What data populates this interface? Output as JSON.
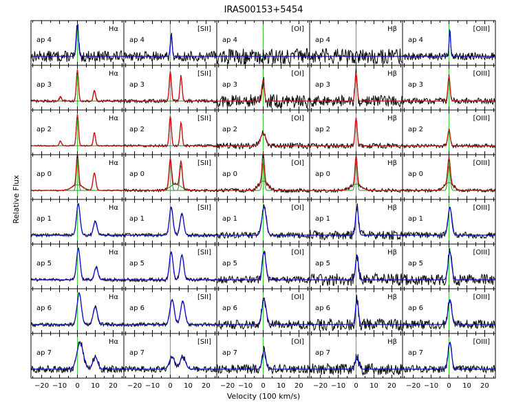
{
  "chart_data": {
    "type": "line",
    "title": "IRAS00153+5454",
    "xlabel": "Velocity (100 km/s)",
    "ylabel": "Relative Flux",
    "xlim": [
      -26,
      26
    ],
    "x_ticks": [
      -20,
      -10,
      0,
      10,
      20
    ],
    "x_tick_labels": [
      "−20",
      "−10",
      "0",
      "10",
      "20"
    ],
    "columns": [
      "Hα",
      "[SII]",
      "[OI]",
      "Hβ",
      "[OIII]"
    ],
    "rows": [
      "ap 4",
      "ap 3",
      "ap 2",
      "ap 0",
      "ap 1",
      "ap 5",
      "ap 6",
      "ap 7"
    ],
    "reference_line_x": 0,
    "colors": {
      "observed": "#000000",
      "total_fit": "#1010d0",
      "multi_fit": "#d01010",
      "components": "#2a8a2a",
      "reference": "#33cc33"
    },
    "panels": [
      {
        "row": "ap 4",
        "col": "Hα",
        "lines": [
          {
            "c": 0,
            "a": 1.0,
            "w": 0.6
          }
        ],
        "noise": 0.18,
        "fit": "single"
      },
      {
        "row": "ap 4",
        "col": "[SII]",
        "lines": [
          {
            "c": 0.5,
            "a": 0.7,
            "w": 0.5
          }
        ],
        "noise": 0.16,
        "fit": "single"
      },
      {
        "row": "ap 4",
        "col": "[OI]",
        "lines": [],
        "noise": 0.25,
        "fit": "single"
      },
      {
        "row": "ap 4",
        "col": "Hβ",
        "lines": [],
        "noise": 0.25,
        "fit": "single"
      },
      {
        "row": "ap 4",
        "col": "[OIII]",
        "lines": [
          {
            "c": 0.5,
            "a": 0.9,
            "w": 0.4
          }
        ],
        "noise": 0.12,
        "fit": "single"
      },
      {
        "row": "ap 3",
        "col": "Hα",
        "lines": [
          {
            "c": 0,
            "a": 1.0,
            "w": 0.6
          },
          {
            "c": 9.5,
            "a": 0.35,
            "w": 0.6
          },
          {
            "c": -9.5,
            "a": 0.15,
            "w": 0.6
          }
        ],
        "noise": 0.04,
        "fit": "multi"
      },
      {
        "row": "ap 3",
        "col": "[SII]",
        "lines": [
          {
            "c": 0,
            "a": 0.95,
            "w": 0.6
          },
          {
            "c": 6,
            "a": 0.8,
            "w": 0.6
          }
        ],
        "noise": 0.06,
        "fit": "multi"
      },
      {
        "row": "ap 3",
        "col": "[OI]",
        "lines": [
          {
            "c": 0,
            "a": 0.7,
            "w": 0.6
          }
        ],
        "noise": 0.22,
        "fit": "multi"
      },
      {
        "row": "ap 3",
        "col": "Hβ",
        "lines": [
          {
            "c": 0,
            "a": 0.9,
            "w": 0.6
          }
        ],
        "noise": 0.18,
        "fit": "multi"
      },
      {
        "row": "ap 3",
        "col": "[OIII]",
        "lines": [
          {
            "c": 0,
            "a": 0.8,
            "w": 0.6
          }
        ],
        "noise": 0.1,
        "fit": "multi"
      },
      {
        "row": "ap 2",
        "col": "Hα",
        "lines": [
          {
            "c": 0,
            "a": 1.0,
            "w": 0.6
          },
          {
            "c": 9.5,
            "a": 0.42,
            "w": 0.6
          },
          {
            "c": -9.5,
            "a": 0.15,
            "w": 0.6
          }
        ],
        "noise": 0.02,
        "fit": "multi"
      },
      {
        "row": "ap 2",
        "col": "[SII]",
        "lines": [
          {
            "c": 0,
            "a": 0.95,
            "w": 0.6
          },
          {
            "c": 6,
            "a": 0.75,
            "w": 0.6
          }
        ],
        "noise": 0.04,
        "fit": "multi"
      },
      {
        "row": "ap 2",
        "col": "[OI]",
        "lines": [
          {
            "c": 0,
            "a": 0.4,
            "w": 1.5
          }
        ],
        "noise": 0.1,
        "fit": "multi"
      },
      {
        "row": "ap 2",
        "col": "Hβ",
        "lines": [
          {
            "c": 0,
            "a": 0.9,
            "w": 0.6
          }
        ],
        "noise": 0.08,
        "fit": "multi"
      },
      {
        "row": "ap 2",
        "col": "[OIII]",
        "lines": [
          {
            "c": 0,
            "a": 0.5,
            "w": 0.7
          }
        ],
        "noise": 0.06,
        "fit": "multi"
      },
      {
        "row": "ap 0",
        "col": "Hα",
        "lines": [
          {
            "c": 0,
            "a": 1.0,
            "w": 0.6
          },
          {
            "c": 0,
            "a": 0.18,
            "w": 3.0
          },
          {
            "c": 9.5,
            "a": 0.55,
            "w": 0.8
          }
        ],
        "noise": 0.02,
        "fit": "multi"
      },
      {
        "row": "ap 0",
        "col": "[SII]",
        "lines": [
          {
            "c": 0,
            "a": 0.9,
            "w": 0.7
          },
          {
            "c": 6,
            "a": 0.8,
            "w": 0.7
          },
          {
            "c": 3,
            "a": 0.2,
            "w": 3.0
          }
        ],
        "noise": 0.04,
        "fit": "multi"
      },
      {
        "row": "ap 0",
        "col": "[OI]",
        "lines": [
          {
            "c": 0,
            "a": 0.9,
            "w": 0.6
          },
          {
            "c": 0,
            "a": 0.3,
            "w": 2.5
          }
        ],
        "noise": 0.06,
        "fit": "multi"
      },
      {
        "row": "ap 0",
        "col": "Hβ",
        "lines": [
          {
            "c": 0,
            "a": 0.9,
            "w": 0.6
          },
          {
            "c": 0,
            "a": 0.2,
            "w": 3.0
          }
        ],
        "noise": 0.06,
        "fit": "multi"
      },
      {
        "row": "ap 0",
        "col": "[OIII]",
        "lines": [
          {
            "c": 0,
            "a": 0.8,
            "w": 0.7
          },
          {
            "c": 0,
            "a": 0.25,
            "w": 2.5
          }
        ],
        "noise": 0.05,
        "fit": "multi"
      },
      {
        "row": "ap 1",
        "col": "Hα",
        "lines": [
          {
            "c": 0.5,
            "a": 1.0,
            "w": 1.0
          },
          {
            "c": 10,
            "a": 0.45,
            "w": 1.0
          }
        ],
        "noise": 0.05,
        "fit": "single"
      },
      {
        "row": "ap 1",
        "col": "[SII]",
        "lines": [
          {
            "c": 0.5,
            "a": 0.9,
            "w": 1.0
          },
          {
            "c": 6.5,
            "a": 0.7,
            "w": 1.0
          }
        ],
        "noise": 0.06,
        "fit": "single"
      },
      {
        "row": "ap 1",
        "col": "[OI]",
        "lines": [
          {
            "c": 0.5,
            "a": 0.9,
            "w": 1.2
          }
        ],
        "noise": 0.1,
        "fit": "single"
      },
      {
        "row": "ap 1",
        "col": "Hβ",
        "lines": [
          {
            "c": 0.5,
            "a": 0.9,
            "w": 0.8
          }
        ],
        "noise": 0.15,
        "fit": "single"
      },
      {
        "row": "ap 1",
        "col": "[OIII]",
        "lines": [
          {
            "c": 0.5,
            "a": 0.9,
            "w": 1.0
          }
        ],
        "noise": 0.1,
        "fit": "single"
      },
      {
        "row": "ap 5",
        "col": "Hα",
        "lines": [
          {
            "c": 0.5,
            "a": 1.0,
            "w": 1.0
          },
          {
            "c": 10.5,
            "a": 0.4,
            "w": 1.0
          }
        ],
        "noise": 0.05,
        "fit": "single"
      },
      {
        "row": "ap 5",
        "col": "[SII]",
        "lines": [
          {
            "c": 0.5,
            "a": 0.9,
            "w": 1.0
          },
          {
            "c": 6.5,
            "a": 0.8,
            "w": 1.0
          }
        ],
        "noise": 0.06,
        "fit": "single"
      },
      {
        "row": "ap 5",
        "col": "[OI]",
        "lines": [
          {
            "c": 0.5,
            "a": 0.9,
            "w": 1.0
          }
        ],
        "noise": 0.12,
        "fit": "single"
      },
      {
        "row": "ap 5",
        "col": "Hβ",
        "lines": [
          {
            "c": 0.5,
            "a": 0.8,
            "w": 0.8
          }
        ],
        "noise": 0.2,
        "fit": "single"
      },
      {
        "row": "ap 5",
        "col": "[OIII]",
        "lines": [
          {
            "c": 0.5,
            "a": 0.9,
            "w": 1.0
          }
        ],
        "noise": 0.18,
        "fit": "single"
      },
      {
        "row": "ap 6",
        "col": "Hα",
        "lines": [
          {
            "c": 1,
            "a": 1.0,
            "w": 1.2
          },
          {
            "c": 10,
            "a": 0.55,
            "w": 1.2
          }
        ],
        "noise": 0.06,
        "fit": "single"
      },
      {
        "row": "ap 6",
        "col": "[SII]",
        "lines": [
          {
            "c": 1,
            "a": 0.8,
            "w": 1.2
          },
          {
            "c": 7,
            "a": 0.75,
            "w": 1.2
          }
        ],
        "noise": 0.06,
        "fit": "single"
      },
      {
        "row": "ap 6",
        "col": "[OI]",
        "lines": [
          {
            "c": 0.5,
            "a": 0.8,
            "w": 1.2
          }
        ],
        "noise": 0.15,
        "fit": "single"
      },
      {
        "row": "ap 6",
        "col": "Hβ",
        "lines": [
          {
            "c": 0.5,
            "a": 0.8,
            "w": 0.8
          }
        ],
        "noise": 0.2,
        "fit": "single"
      },
      {
        "row": "ap 6",
        "col": "[OIII]",
        "lines": [
          {
            "c": 0.5,
            "a": 0.8,
            "w": 1.0
          }
        ],
        "noise": 0.15,
        "fit": "single"
      },
      {
        "row": "ap 7",
        "col": "Hα",
        "lines": [
          {
            "c": 1.5,
            "a": 0.85,
            "w": 1.8
          },
          {
            "c": 10,
            "a": 0.4,
            "w": 1.3
          }
        ],
        "noise": 0.12,
        "fit": "single"
      },
      {
        "row": "ap 7",
        "col": "[SII]",
        "lines": [
          {
            "c": 1,
            "a": 0.4,
            "w": 1.5
          },
          {
            "c": 7,
            "a": 0.4,
            "w": 1.5
          }
        ],
        "noise": 0.1,
        "fit": "single"
      },
      {
        "row": "ap 7",
        "col": "[OI]",
        "lines": [
          {
            "c": 0.5,
            "a": 0.6,
            "w": 1.0
          }
        ],
        "noise": 0.15,
        "fit": "single"
      },
      {
        "row": "ap 7",
        "col": "Hβ",
        "lines": [
          {
            "c": 0.5,
            "a": 0.4,
            "w": 1.0
          }
        ],
        "noise": 0.18,
        "fit": "single"
      },
      {
        "row": "ap 7",
        "col": "[OIII]",
        "lines": [
          {
            "c": 0.5,
            "a": 0.85,
            "w": 1.0
          }
        ],
        "noise": 0.12,
        "fit": "single"
      }
    ]
  }
}
